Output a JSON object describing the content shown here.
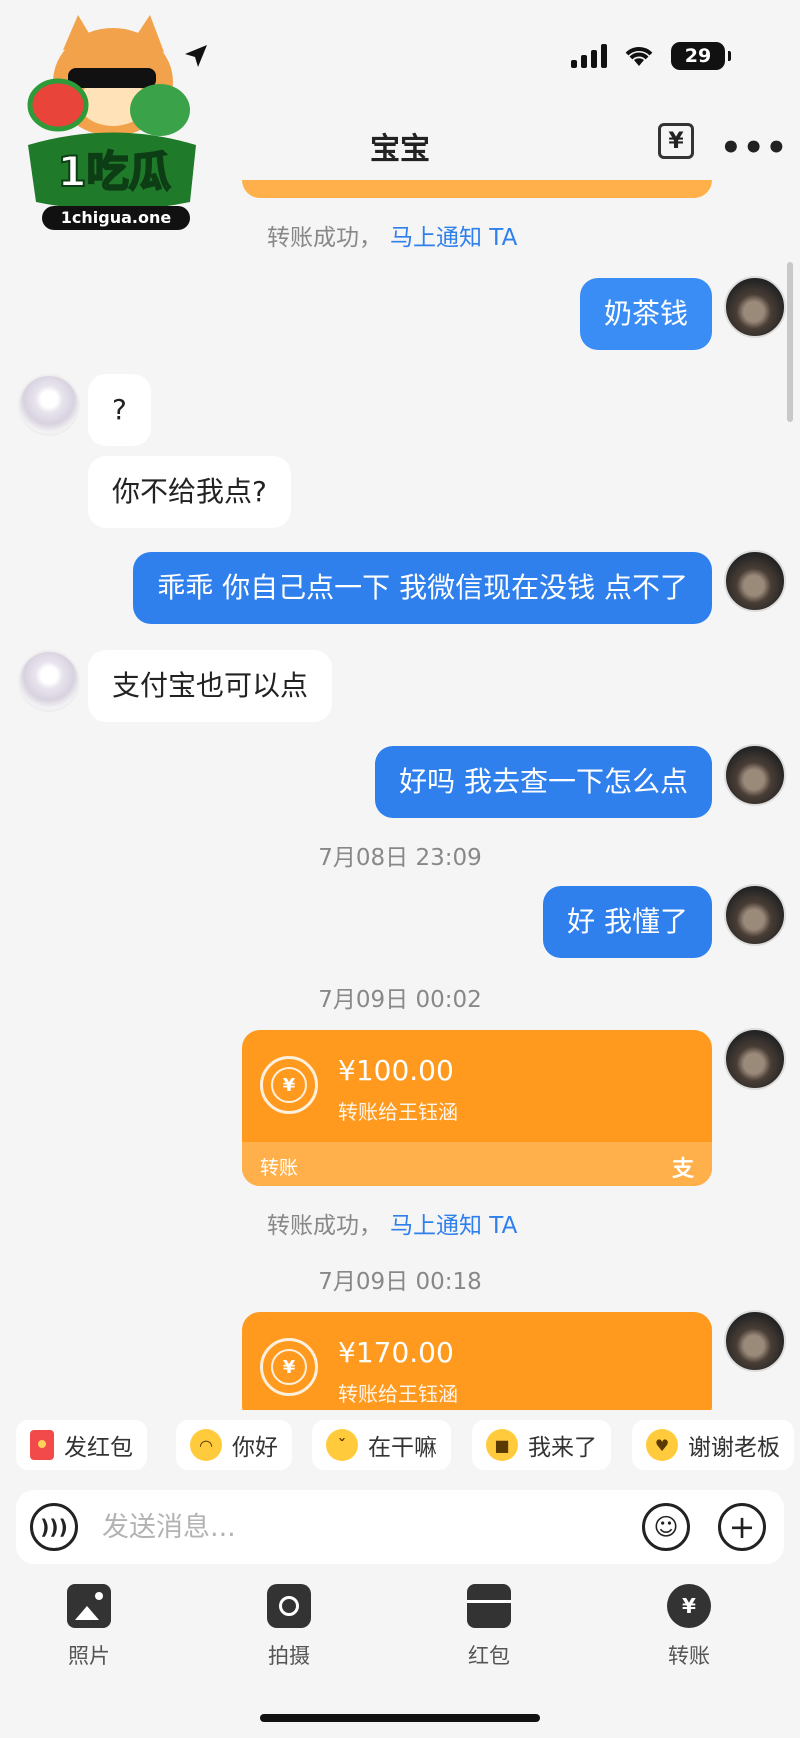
{
  "status_bar": {
    "battery": "29"
  },
  "header": {
    "title": "宝宝",
    "transfer_icon_glyph": "¥",
    "more_glyph": "•••"
  },
  "logo": {
    "text": "1吃瓜",
    "domain": "1chigua.one"
  },
  "messages": [
    {
      "type": "transfer_note",
      "text": "转账成功，",
      "link": "马上通知 TA"
    },
    {
      "type": "out",
      "text": "奶茶钱"
    },
    {
      "type": "in",
      "text": "?"
    },
    {
      "type": "in",
      "text": "你不给我点?"
    },
    {
      "type": "out",
      "text": "乖乖 你自己点一下 我微信现在没钱 点不了"
    },
    {
      "type": "in",
      "text": "支付宝也可以点"
    },
    {
      "type": "out",
      "text": "好吗 我去查一下怎么点"
    },
    {
      "type": "time",
      "text": "7月08日 23:09"
    },
    {
      "type": "out",
      "text": "好 我懂了"
    },
    {
      "type": "time",
      "text": "7月09日 00:02"
    },
    {
      "type": "transfer",
      "amount": "¥100.00",
      "desc": "转账给王钰涵",
      "label": "转账",
      "brand": "支"
    },
    {
      "type": "transfer_note",
      "text": "转账成功，",
      "link": "马上通知 TA"
    },
    {
      "type": "time",
      "text": "7月09日 00:18"
    },
    {
      "type": "transfer",
      "amount": "¥170.00",
      "desc": "转账给王钰涵"
    }
  ],
  "quick_replies": [
    {
      "label": "发红包",
      "icon": "red-packet-icon"
    },
    {
      "label": "你好",
      "icon": "wave-emoji-icon"
    },
    {
      "label": "在干嘛",
      "icon": "curious-emoji-icon"
    },
    {
      "label": "我来了",
      "icon": "sunglasses-emoji-icon"
    },
    {
      "label": "谢谢老板",
      "icon": "thanks-emoji-icon"
    }
  ],
  "input": {
    "placeholder": "发送消息..."
  },
  "toolbar": [
    {
      "label": "照片",
      "icon": "photo-icon"
    },
    {
      "label": "拍摄",
      "icon": "camera-icon"
    },
    {
      "label": "红包",
      "icon": "red-packet-icon"
    },
    {
      "label": "转账",
      "icon": "transfer-icon"
    }
  ],
  "colors": {
    "bubble_out": "#2f80ed",
    "transfer_card": "#ff9a1f",
    "background": "#f5f5f5"
  }
}
